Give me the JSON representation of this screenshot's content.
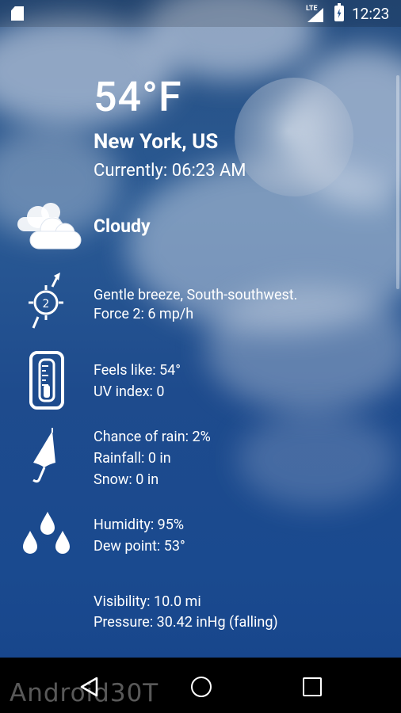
{
  "status_bar": {
    "network": "LTE",
    "time": "12:23"
  },
  "weather": {
    "temperature": "54°F",
    "location": "New York, US",
    "current_time": "Currently: 06:23 AM",
    "condition": "Cloudy"
  },
  "wind": {
    "force_badge": "2",
    "line1": "Gentle breeze, South-southwest.",
    "line2": "Force 2: 6 mp/h"
  },
  "feels": {
    "line1": "Feels like: 54°",
    "line2": "UV index: 0"
  },
  "precip": {
    "line1": "Chance of rain: 2%",
    "line2": "Rainfall: 0 in",
    "line3": "Snow: 0 in"
  },
  "humidity": {
    "line1": "Humidity: 95%",
    "line2": "Dew point: 53°"
  },
  "visibility": {
    "line1": "Visibility: 10.0 mi",
    "line2": "Pressure: 30.42 inHg (falling)"
  },
  "watermark": "Android30T",
  "icons": {
    "sd": "sd-card-icon",
    "signal": "signal-icon",
    "battery": "battery-charging-icon",
    "cloud": "cloud-icon",
    "wind": "wind-compass-icon",
    "thermometer": "thermometer-icon",
    "umbrella": "umbrella-icon",
    "drops": "water-drops-icon",
    "back": "back-icon",
    "home": "home-icon",
    "recent": "recent-apps-icon"
  }
}
